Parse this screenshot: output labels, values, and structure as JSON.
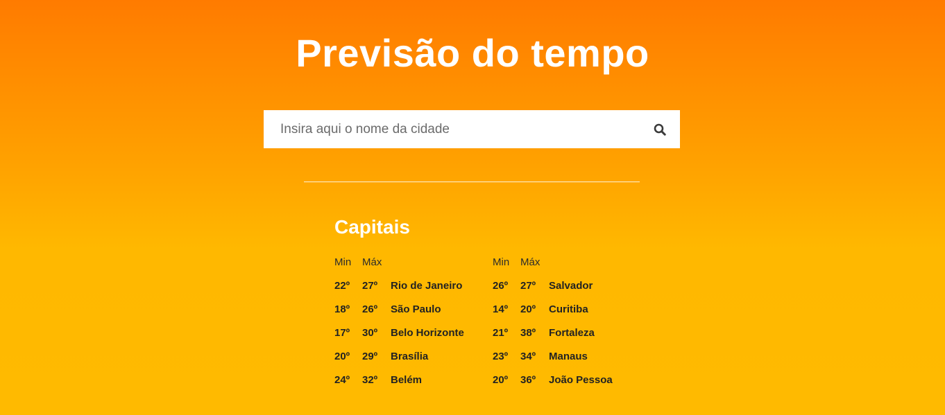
{
  "title": "Previsão do tempo",
  "search": {
    "placeholder": "Insira aqui o nome da cidade",
    "value": "",
    "icon": "search-icon"
  },
  "capitais": {
    "heading": "Capitais",
    "min_label": "Min",
    "max_label": "Máx",
    "left": [
      {
        "min": "22º",
        "max": "27º",
        "city": "Rio de Janeiro"
      },
      {
        "min": "18º",
        "max": "26º",
        "city": "São Paulo"
      },
      {
        "min": "17º",
        "max": "30º",
        "city": "Belo Horizonte"
      },
      {
        "min": "20º",
        "max": "29º",
        "city": "Brasília"
      },
      {
        "min": "24º",
        "max": "32º",
        "city": "Belém"
      }
    ],
    "right": [
      {
        "min": "26º",
        "max": "27º",
        "city": "Salvador"
      },
      {
        "min": "14º",
        "max": "20º",
        "city": "Curitiba"
      },
      {
        "min": "21º",
        "max": "38º",
        "city": "Fortaleza"
      },
      {
        "min": "23º",
        "max": "34º",
        "city": "Manaus"
      },
      {
        "min": "20º",
        "max": "36º",
        "city": "João Pessoa"
      }
    ]
  },
  "colors": {
    "gradient_top": "#ff7b00",
    "gradient_bottom": "#ffba00",
    "text_light": "#ffffff",
    "text_dark": "#222222"
  }
}
